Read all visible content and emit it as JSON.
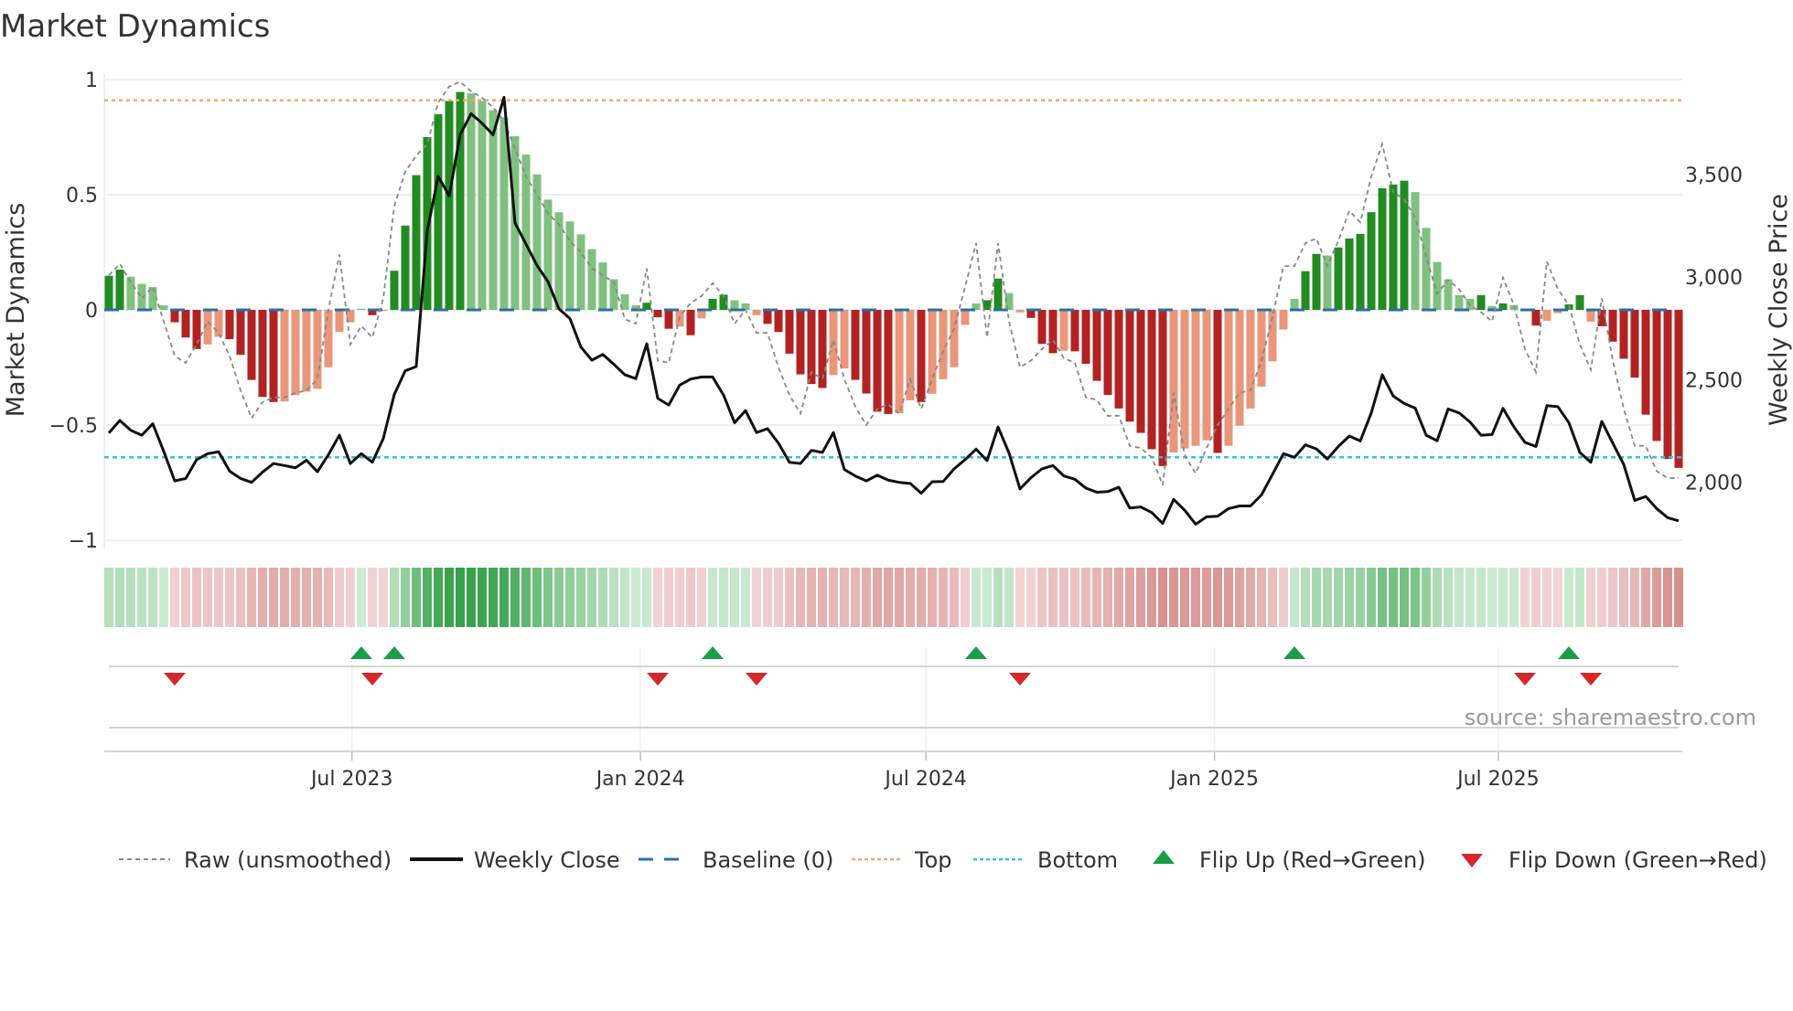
{
  "title": "Market Dynamics",
  "source": "source: sharemaestro.com",
  "chart_data": {
    "type": "bar",
    "frequency": "weekly",
    "start_date": "2023-01-27",
    "y_left": {
      "label": "Market Dynamics",
      "range": [
        -1,
        1
      ],
      "ticks": [
        1,
        0.5,
        0,
        -0.5,
        -1
      ],
      "tick_labels": [
        "1",
        "0.5",
        "0",
        "−0.5",
        "−1"
      ]
    },
    "y_right": {
      "label": "Weekly Close Price",
      "ticks": [
        3500,
        3000,
        2500,
        2000
      ],
      "tick_labels": [
        "3,500",
        "3,000",
        "2,500",
        "2,000"
      ]
    },
    "x_ticks": [
      {
        "date": "2023-07-01",
        "label": "Jul 2023"
      },
      {
        "date": "2024-01-01",
        "label": "Jan 2024"
      },
      {
        "date": "2024-07-01",
        "label": "Jul 2024"
      },
      {
        "date": "2025-01-01",
        "label": "Jan 2025"
      },
      {
        "date": "2025-07-01",
        "label": "Jul 2025"
      }
    ],
    "top_level": 0.91,
    "bottom_level": -0.64,
    "baseline": 0,
    "smoothed": [
      0.148,
      0.175,
      0.144,
      0.113,
      0.099,
      0.02,
      -0.054,
      -0.12,
      -0.17,
      -0.15,
      -0.117,
      -0.127,
      -0.195,
      -0.304,
      -0.378,
      -0.4,
      -0.397,
      -0.37,
      -0.355,
      -0.343,
      -0.249,
      -0.096,
      -0.054,
      0.005,
      -0.023,
      -0.005,
      0.17,
      0.366,
      0.585,
      0.75,
      0.85,
      0.907,
      0.946,
      0.94,
      0.907,
      0.867,
      0.836,
      0.754,
      0.674,
      0.588,
      0.479,
      0.424,
      0.384,
      0.328,
      0.264,
      0.206,
      0.133,
      0.068,
      0.02,
      0.031,
      -0.032,
      -0.082,
      -0.072,
      -0.11,
      -0.037,
      0.048,
      0.066,
      0.042,
      0.028,
      -0.023,
      -0.061,
      -0.096,
      -0.19,
      -0.28,
      -0.322,
      -0.339,
      -0.283,
      -0.254,
      -0.304,
      -0.363,
      -0.442,
      -0.452,
      -0.449,
      -0.393,
      -0.4,
      -0.364,
      -0.301,
      -0.249,
      -0.065,
      0.028,
      0.042,
      0.136,
      0.073,
      -0.011,
      -0.035,
      -0.148,
      -0.188,
      -0.177,
      -0.18,
      -0.234,
      -0.308,
      -0.369,
      -0.428,
      -0.485,
      -0.534,
      -0.605,
      -0.678,
      -0.619,
      -0.602,
      -0.59,
      -0.566,
      -0.621,
      -0.59,
      -0.503,
      -0.428,
      -0.333,
      -0.223,
      -0.085,
      0.048,
      0.168,
      0.243,
      0.236,
      0.271,
      0.31,
      0.33,
      0.424,
      0.528,
      0.544,
      0.561,
      0.511,
      0.356,
      0.208,
      0.133,
      0.064,
      0.048,
      0.064,
      0.017,
      0.028,
      0.021,
      -0.006,
      -0.068,
      -0.047,
      -0.014,
      0.024,
      0.064,
      -0.051,
      -0.071,
      -0.138,
      -0.212,
      -0.294,
      -0.455,
      -0.569,
      -0.647,
      -0.686
    ],
    "raw": [
      0.15,
      0.2,
      0.12,
      0.05,
      0.1,
      -0.05,
      -0.2,
      -0.23,
      -0.15,
      -0.05,
      -0.1,
      -0.2,
      -0.35,
      -0.47,
      -0.4,
      -0.38,
      -0.38,
      -0.36,
      -0.35,
      -0.3,
      0.0,
      0.24,
      -0.15,
      -0.07,
      -0.12,
      0.05,
      0.45,
      0.6,
      0.67,
      0.72,
      0.9,
      0.97,
      0.99,
      0.95,
      0.92,
      0.88,
      0.82,
      0.7,
      0.58,
      0.5,
      0.42,
      0.37,
      0.3,
      0.25,
      0.18,
      0.15,
      0.12,
      -0.04,
      -0.06,
      0.18,
      -0.22,
      -0.23,
      -0.03,
      0.03,
      0.06,
      0.116,
      0.06,
      -0.06,
      0.0,
      -0.1,
      -0.1,
      -0.25,
      -0.37,
      -0.45,
      -0.27,
      -0.3,
      -0.13,
      -0.3,
      -0.42,
      -0.5,
      -0.43,
      -0.41,
      -0.45,
      -0.3,
      -0.43,
      -0.3,
      -0.18,
      -0.08,
      0.1,
      0.29,
      -0.12,
      0.29,
      -0.05,
      -0.25,
      -0.22,
      -0.17,
      -0.13,
      -0.21,
      -0.23,
      -0.38,
      -0.39,
      -0.46,
      -0.46,
      -0.59,
      -0.6,
      -0.64,
      -0.76,
      -0.36,
      -0.63,
      -0.71,
      -0.6,
      -0.5,
      -0.43,
      -0.36,
      -0.35,
      -0.22,
      -0.03,
      0.19,
      0.19,
      0.29,
      0.31,
      0.19,
      0.3,
      0.43,
      0.38,
      0.58,
      0.72,
      0.51,
      0.48,
      0.4,
      0.23,
      0.07,
      0.13,
      0.09,
      0.02,
      -0.01,
      -0.05,
      0.14,
      0.02,
      -0.17,
      -0.27,
      0.21,
      0.09,
      0.02,
      -0.15,
      -0.26,
      0.05,
      -0.22,
      -0.43,
      -0.59,
      -0.59,
      -0.7,
      -0.73,
      -0.73
    ],
    "close": [
      2240,
      2301,
      2253,
      2229,
      2285,
      2150,
      2006,
      2018,
      2110,
      2139,
      2148,
      2054,
      2018,
      1999,
      2049,
      2091,
      2081,
      2070,
      2107,
      2051,
      2134,
      2229,
      2091,
      2139,
      2097,
      2213,
      2428,
      2543,
      2564,
      3224,
      3492,
      3396,
      3694,
      3797,
      3750,
      3694,
      3877,
      3264,
      3161,
      3057,
      2978,
      2845,
      2798,
      2659,
      2595,
      2623,
      2575,
      2524,
      2505,
      2675,
      2409,
      2376,
      2473,
      2503,
      2513,
      2513,
      2424,
      2290,
      2349,
      2242,
      2261,
      2190,
      2097,
      2091,
      2155,
      2145,
      2242,
      2062,
      2030,
      2006,
      2034,
      2010,
      1999,
      1994,
      1946,
      2002,
      2003,
      2065,
      2110,
      2161,
      2105,
      2269,
      2142,
      1967,
      2022,
      2065,
      2081,
      2030,
      2014,
      1971,
      1951,
      1954,
      1975,
      1874,
      1879,
      1852,
      1799,
      1916,
      1863,
      1795,
      1831,
      1834,
      1871,
      1884,
      1884,
      1938,
      2038,
      2139,
      2121,
      2182,
      2162,
      2113,
      2174,
      2225,
      2201,
      2338,
      2524,
      2420,
      2384,
      2361,
      2229,
      2202,
      2357,
      2338,
      2293,
      2229,
      2232,
      2360,
      2269,
      2194,
      2174,
      2373,
      2368,
      2290,
      2145,
      2097,
      2296,
      2190,
      2086,
      1911,
      1930,
      1871,
      1827,
      1811
    ],
    "flip_up_weeks": [
      24,
      27,
      56,
      80,
      109,
      134
    ],
    "flip_down_weeks": [
      7,
      25,
      51,
      60,
      84,
      130,
      136
    ],
    "legend": {
      "position": "bottom",
      "items": [
        {
          "key": "raw",
          "label": "Raw (unsmoothed)"
        },
        {
          "key": "close",
          "label": "Weekly Close"
        },
        {
          "key": "baseline",
          "label": "Baseline (0)"
        },
        {
          "key": "top",
          "label": "Top"
        },
        {
          "key": "bottom",
          "label": "Bottom"
        },
        {
          "key": "flip_up",
          "label": "Flip Up (Red→Green)"
        },
        {
          "key": "flip_down",
          "label": "Flip Down (Green→Red)"
        }
      ]
    },
    "colors": {
      "green_strong": "#228b22",
      "green_weak": "#80c080",
      "red_strong": "#b22222",
      "red_weak": "#e9967a",
      "close": "#111111",
      "raw": "#888888",
      "baseline": "#2e6f9e",
      "top": "#f0a868",
      "bottom": "#33c3d3",
      "flip_up": "#1a9e4a",
      "flip_down": "#d62728"
    }
  }
}
